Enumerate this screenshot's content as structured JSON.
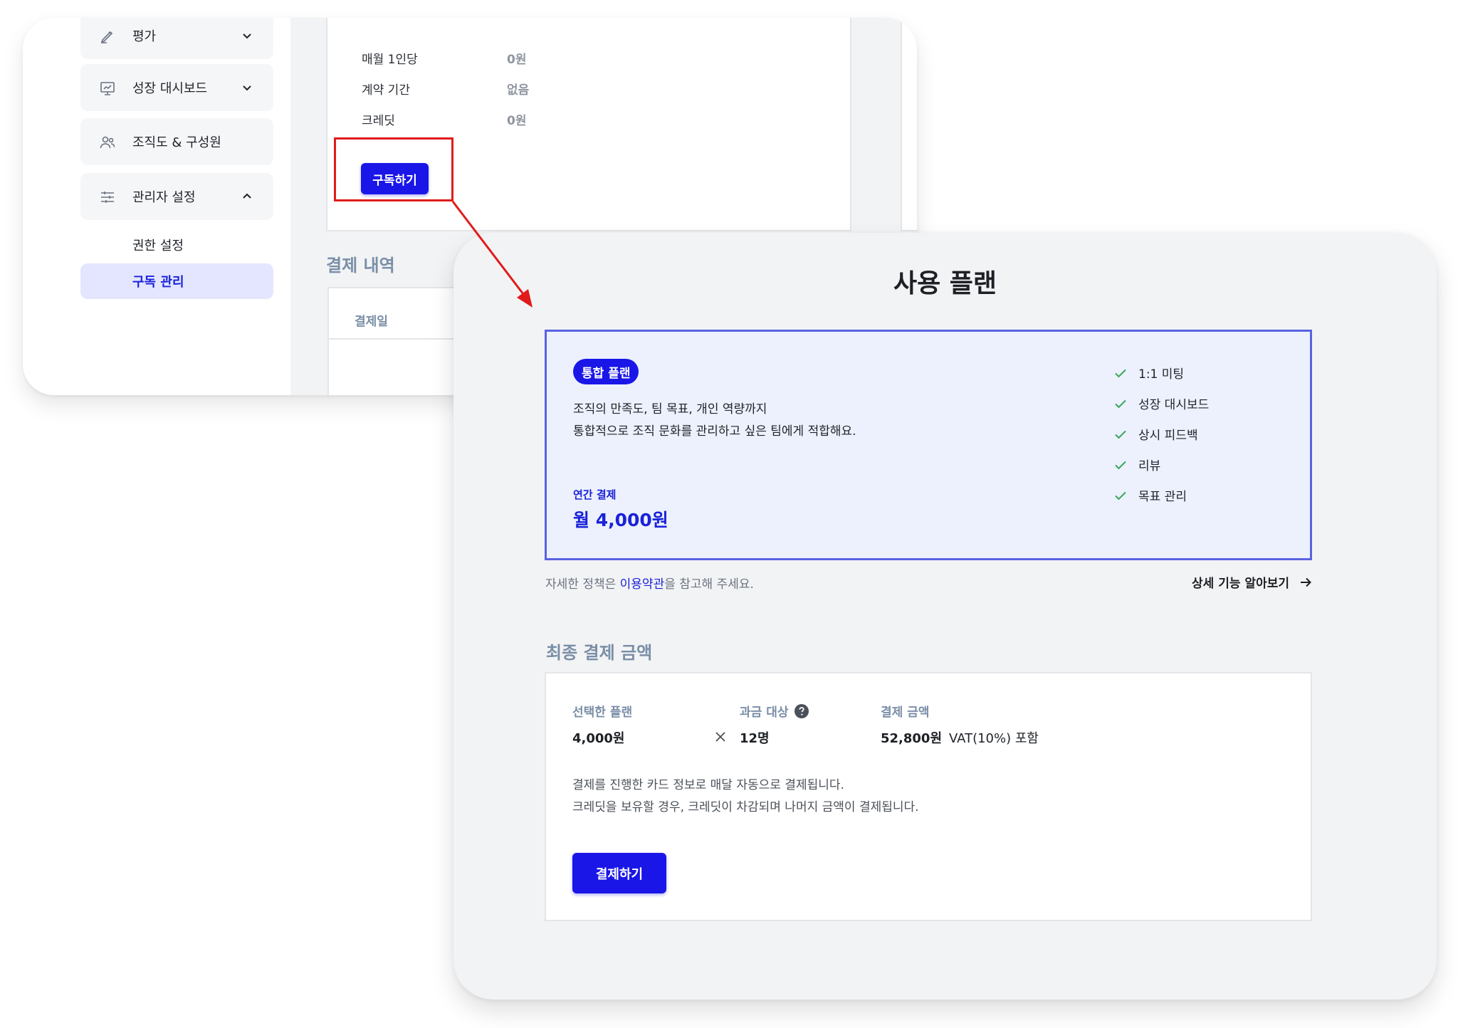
{
  "sidebar": {
    "items": [
      {
        "label": "평가",
        "icon": "pen-icon",
        "chevron": "chevron-down-icon"
      },
      {
        "label": "성장 대시보드",
        "icon": "dashboard-icon",
        "chevron": "chevron-down-icon"
      },
      {
        "label": "조직도 & 구성원",
        "icon": "users-icon"
      },
      {
        "label": "관리자 설정",
        "icon": "sliders-icon",
        "chevron": "chevron-up-icon"
      }
    ],
    "subitems": [
      {
        "label": "권한 설정",
        "active": false
      },
      {
        "label": "구독 관리",
        "active": true
      }
    ]
  },
  "back_panel": {
    "rows": [
      {
        "key": "매월 1인당",
        "value": "0원"
      },
      {
        "key": "계약 기간",
        "value": "없음"
      },
      {
        "key": "크레딧",
        "value": "0원"
      }
    ],
    "subscribe_label": "구독하기",
    "history_title": "결제 내역",
    "history_col": "결제일"
  },
  "front": {
    "title": "사용 플랜",
    "plan": {
      "badge": "통합 플랜",
      "desc_line1": "조직의 만족도, 팀 목표, 개인 역량까지",
      "desc_line2": "통합적으로 조직 문화를 관리하고 싶은 팀에게 적합해요.",
      "billing_label": "연간 결제",
      "price": "월 4,000원",
      "features": [
        "1:1 미팅",
        "성장 대시보드",
        "상시 피드백",
        "리뷰",
        "목표 관리"
      ]
    },
    "policy": {
      "prefix": "자세한 정책은 ",
      "link": "이용약관",
      "suffix": "을 참고해 주세요."
    },
    "detail_link": "상세 기능 알아보기",
    "final": {
      "title": "최종 결제 금액",
      "selected_plan_label": "선택한 플랜",
      "selected_plan_value": "4,000원",
      "billing_target_label": "과금 대상",
      "billing_target_value": "12명",
      "amount_label": "결제 금액",
      "amount_value": "52,800원",
      "vat_note": "VAT(10%) 포함",
      "notice_line1": "결제를 진행한 카드 정보로 매달 자동으로 결제됩니다.",
      "notice_line2": "크레딧을 보유할 경우, 크레딧이 차감되며 나머지 금액이 결제됩니다.",
      "pay_label": "결제하기"
    }
  },
  "colors": {
    "accent": "#1a16e8",
    "highlight_red": "#e11b1b",
    "muted_heading": "#7a8ea7",
    "plan_bg": "#ecf1fd",
    "check_green": "#3aa65a"
  }
}
